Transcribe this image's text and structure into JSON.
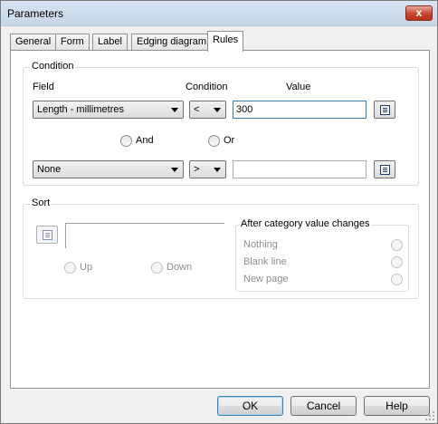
{
  "window": {
    "title": "Parameters",
    "close_glyph": "x"
  },
  "tabs": [
    {
      "label": "General"
    },
    {
      "label": "Form"
    },
    {
      "label": "Label"
    },
    {
      "label": "Edging diagram"
    },
    {
      "label": "Rules",
      "active": true
    }
  ],
  "condition_group": {
    "title": "Condition",
    "col_field": "Field",
    "col_condition": "Condition",
    "col_value": "Value",
    "row1": {
      "field": "Length - millimetres",
      "operator": "<",
      "value": "300"
    },
    "connector_and": "And",
    "connector_or": "Or",
    "row2": {
      "field": "None",
      "operator": ">",
      "value": ""
    }
  },
  "sort_group": {
    "title": "Sort",
    "field_value": "",
    "up": "Up",
    "down": "Down",
    "after_change": {
      "title": "After category value changes",
      "options": [
        "Nothing",
        "Blank line",
        "New page"
      ]
    }
  },
  "buttons": {
    "ok": "OK",
    "cancel": "Cancel",
    "help": "Help"
  },
  "icons": {
    "close": "close-icon",
    "list": "list-icon",
    "dropdown": "chevron-down-icon",
    "grip": "resize-grip-icon"
  }
}
